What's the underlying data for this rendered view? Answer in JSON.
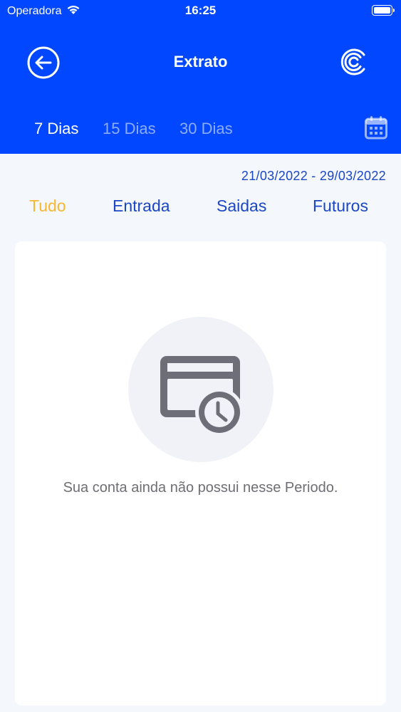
{
  "status_bar": {
    "carrier": "Operadora",
    "time": "16:25"
  },
  "header": {
    "title": "Extrato",
    "back_icon": "arrow-left-circle-icon",
    "logo_icon": "brand-logo-icon"
  },
  "period_tabs": [
    {
      "label": "7 Dias",
      "active": true
    },
    {
      "label": "15 Dias",
      "active": false
    },
    {
      "label": "30 Dias",
      "active": false
    }
  ],
  "calendar_icon": "calendar-icon",
  "date_range": "21/03/2022 - 29/03/2022",
  "filter_tabs": [
    {
      "label": "Tudo",
      "active": true
    },
    {
      "label": "Entrada",
      "active": false
    },
    {
      "label": "Saidas",
      "active": false
    },
    {
      "label": "Futuros",
      "active": false
    }
  ],
  "empty_state": {
    "icon": "card-clock-icon",
    "message": "Sua conta ainda não possui nesse Periodo."
  },
  "colors": {
    "header_bg": "#0047ff",
    "accent": "#f7b733",
    "link": "#1b46c4"
  }
}
